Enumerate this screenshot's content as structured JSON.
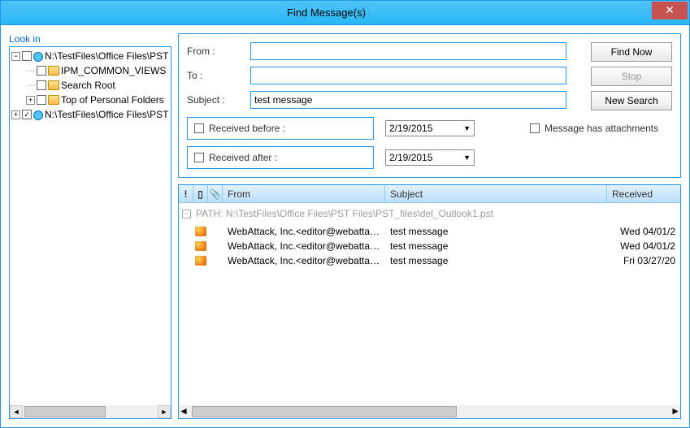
{
  "window": {
    "title": "Find Message(s)"
  },
  "sidebar": {
    "label": "Look in",
    "items": [
      {
        "toggle": "-",
        "checked": false,
        "icon": "pst",
        "label": "N:\\TestFiles\\Office Files\\PST"
      },
      {
        "toggle": "",
        "checked": false,
        "icon": "folder",
        "label": "IPM_COMMON_VIEWS",
        "indent": 1
      },
      {
        "toggle": "",
        "checked": false,
        "icon": "folder",
        "label": "Search Root",
        "indent": 1
      },
      {
        "toggle": "+",
        "checked": false,
        "icon": "folder",
        "label": "Top of Personal Folders",
        "indent": 1
      },
      {
        "toggle": "+",
        "checked": true,
        "icon": "pst",
        "label": "N:\\TestFiles\\Office Files\\PST"
      }
    ]
  },
  "form": {
    "from_label": "From :",
    "from_value": "",
    "to_label": "To :",
    "to_value": "",
    "subject_label": "Subject :",
    "subject_value": "test message",
    "received_before_label": "Received before :",
    "received_before_date": "2/19/2015",
    "received_after_label": "Received after :",
    "received_after_date": "2/19/2015",
    "attachments_label": "Message has attachments"
  },
  "buttons": {
    "find": "Find Now",
    "stop": "Stop",
    "new_search": "New Search"
  },
  "results": {
    "cols": {
      "from": "From",
      "subject": "Subject",
      "received": "Received"
    },
    "path_label": "PATH:  N:\\TestFiles\\Office Files\\PST Files\\PST_files\\del_Outlook1.pst",
    "rows": [
      {
        "from": "WebAttack, Inc.<editor@webattack.c...",
        "subject": "test message",
        "received": "Wed 04/01/2"
      },
      {
        "from": "WebAttack, Inc.<editor@webattack.c...",
        "subject": "test message",
        "received": "Wed 04/01/2"
      },
      {
        "from": "WebAttack, Inc.<editor@webattack.c...",
        "subject": "test message",
        "received": "Fri 03/27/20"
      }
    ]
  }
}
